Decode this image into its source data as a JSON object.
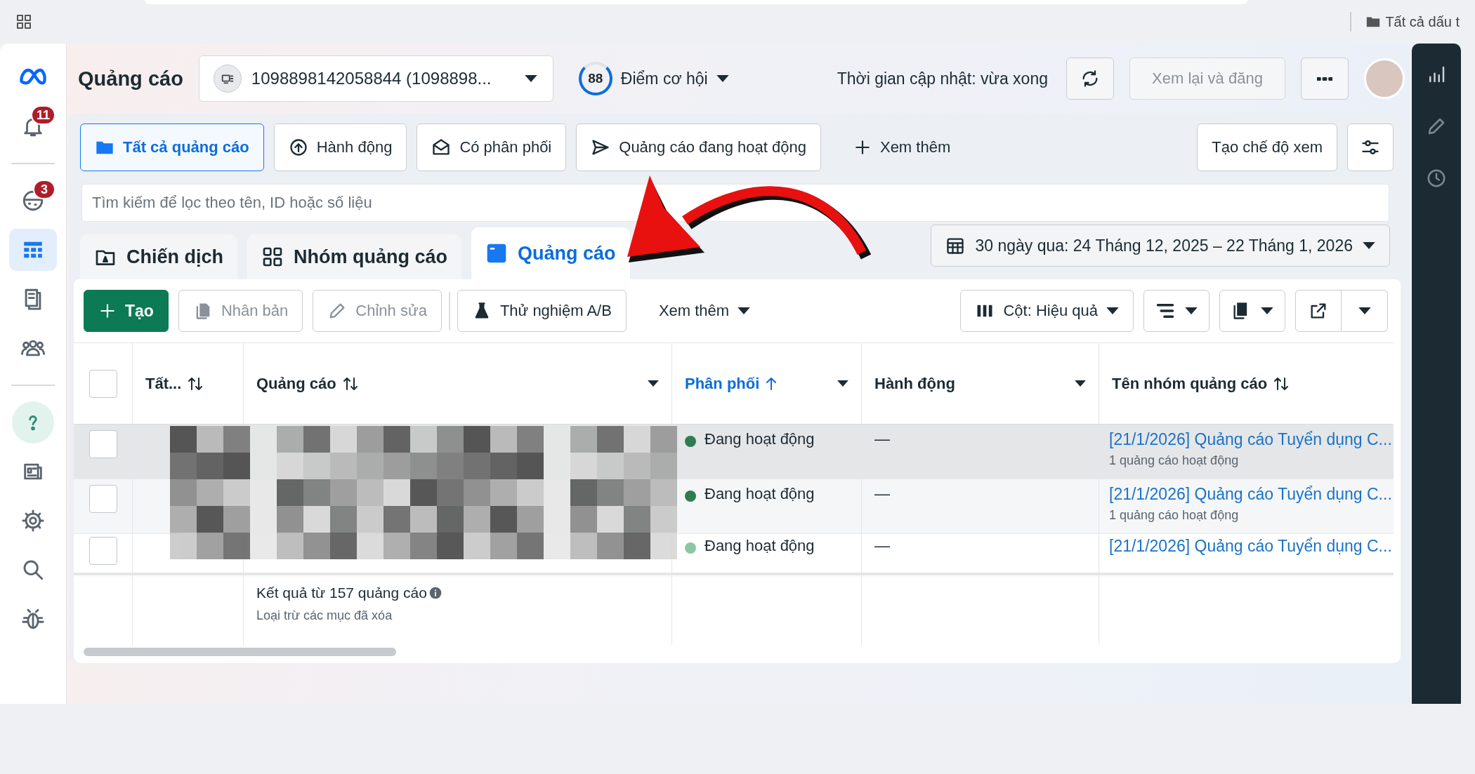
{
  "browser": {
    "bookmark": "Tất cả dấu t"
  },
  "sidebar": {
    "groups": [
      [
        {
          "kind": "logo",
          "selected": false
        },
        {
          "kind": "bell",
          "badge": "11",
          "selected": false
        }
      ],
      [
        {
          "kind": "emoji",
          "badge": "3",
          "selected": false
        },
        {
          "kind": "table",
          "selected": true
        },
        {
          "kind": "pages",
          "selected": false
        },
        {
          "kind": "people",
          "selected": false
        }
      ],
      [
        {
          "kind": "help",
          "selected": false
        },
        {
          "kind": "newspaper",
          "selected": false
        },
        {
          "kind": "gear",
          "selected": false
        },
        {
          "kind": "search",
          "selected": false
        },
        {
          "kind": "bug",
          "selected": false
        }
      ]
    ]
  },
  "right_rail": {
    "items": [
      {
        "kind": "chart",
        "selected": false
      },
      {
        "kind": "pencil",
        "selected": false
      },
      {
        "kind": "clock",
        "selected": false
      }
    ]
  },
  "header": {
    "title": "Quảng cáo",
    "account": "1098898142058844 (1098898...",
    "score": "88",
    "score_label": "Điểm cơ hội",
    "updated": "Thời gian cập nhật: vừa xong",
    "review": {
      "label": "Xem lại và đăng",
      "disabled": true
    }
  },
  "filters": [
    {
      "label": "Tất cả quảng cáo",
      "kind": "folder",
      "selected": true
    },
    {
      "label": "Hành động",
      "kind": "upload",
      "selected": false
    },
    {
      "label": "Có phân phối",
      "kind": "envelope",
      "selected": false
    },
    {
      "label": "Quảng cáo đang hoạt động",
      "kind": "send",
      "selected": false
    }
  ],
  "more_filters": "Xem thêm",
  "create_view": "Tạo chế độ xem",
  "search": {
    "placeholder": "Tìm kiếm để lọc theo tên, ID hoặc số liệu"
  },
  "level_tabs": [
    {
      "label": "Chiến dịch",
      "kind": "campaign",
      "selected": false
    },
    {
      "label": "Nhóm quảng cáo",
      "kind": "adset",
      "selected": false
    },
    {
      "label": "Quảng cáo",
      "kind": "ad",
      "selected": true
    }
  ],
  "date_range": "30 ngày qua: 24 Tháng 12, 2025 – 22 Tháng 1, 2026",
  "toolbar": {
    "create": "Tạo",
    "actions": [
      {
        "label": "Nhân bản",
        "kind": "copy",
        "disabled": true
      },
      {
        "label": "Chỉnh sửa",
        "kind": "pencil",
        "disabled": true
      },
      {
        "label": "Thử nghiệm A/B",
        "kind": "flask",
        "disabled": false
      }
    ],
    "more": "Xem thêm",
    "columns": "Cột: Hiệu quả"
  },
  "table": {
    "select_all": {
      "checked": false
    },
    "columns": [
      {
        "label": "Tất...",
        "kind": "sortable",
        "menu": false
      },
      {
        "label": "Quảng cáo",
        "kind": "sortable",
        "menu": true
      },
      {
        "label": "Phân phối",
        "kind": "sorted",
        "menu": true
      },
      {
        "label": "Hành động",
        "kind": "plain",
        "menu": true
      },
      {
        "label": "Tên nhóm quảng cáo",
        "kind": "sortable",
        "menu": false
      }
    ],
    "rows": [
      {
        "highlighted": true,
        "checked": false,
        "delivery": "Đang hoạt động",
        "color": "#2e7d4f",
        "actions": "—",
        "adset": "[21/1/2026] Quảng cáo Tuyển dụng C...",
        "adset_note": "1 quảng cáo hoạt động"
      },
      {
        "highlighted": false,
        "checked": false,
        "delivery": "Đang hoạt động",
        "color": "#2e7d4f",
        "actions": "—",
        "adset": "[21/1/2026] Quảng cáo Tuyển dụng C...",
        "adset_note": "1 quảng cáo hoạt động"
      },
      {
        "highlighted": false,
        "checked": false,
        "delivery": "Đang hoạt động",
        "color": "#8cc7a4",
        "actions": "—",
        "adset": "[21/1/2026] Quảng cáo Tuyển dụng C..."
      }
    ],
    "results": "Kết quả từ 157 quảng cáo",
    "results_note": "Loại trừ các mục đã xóa"
  }
}
